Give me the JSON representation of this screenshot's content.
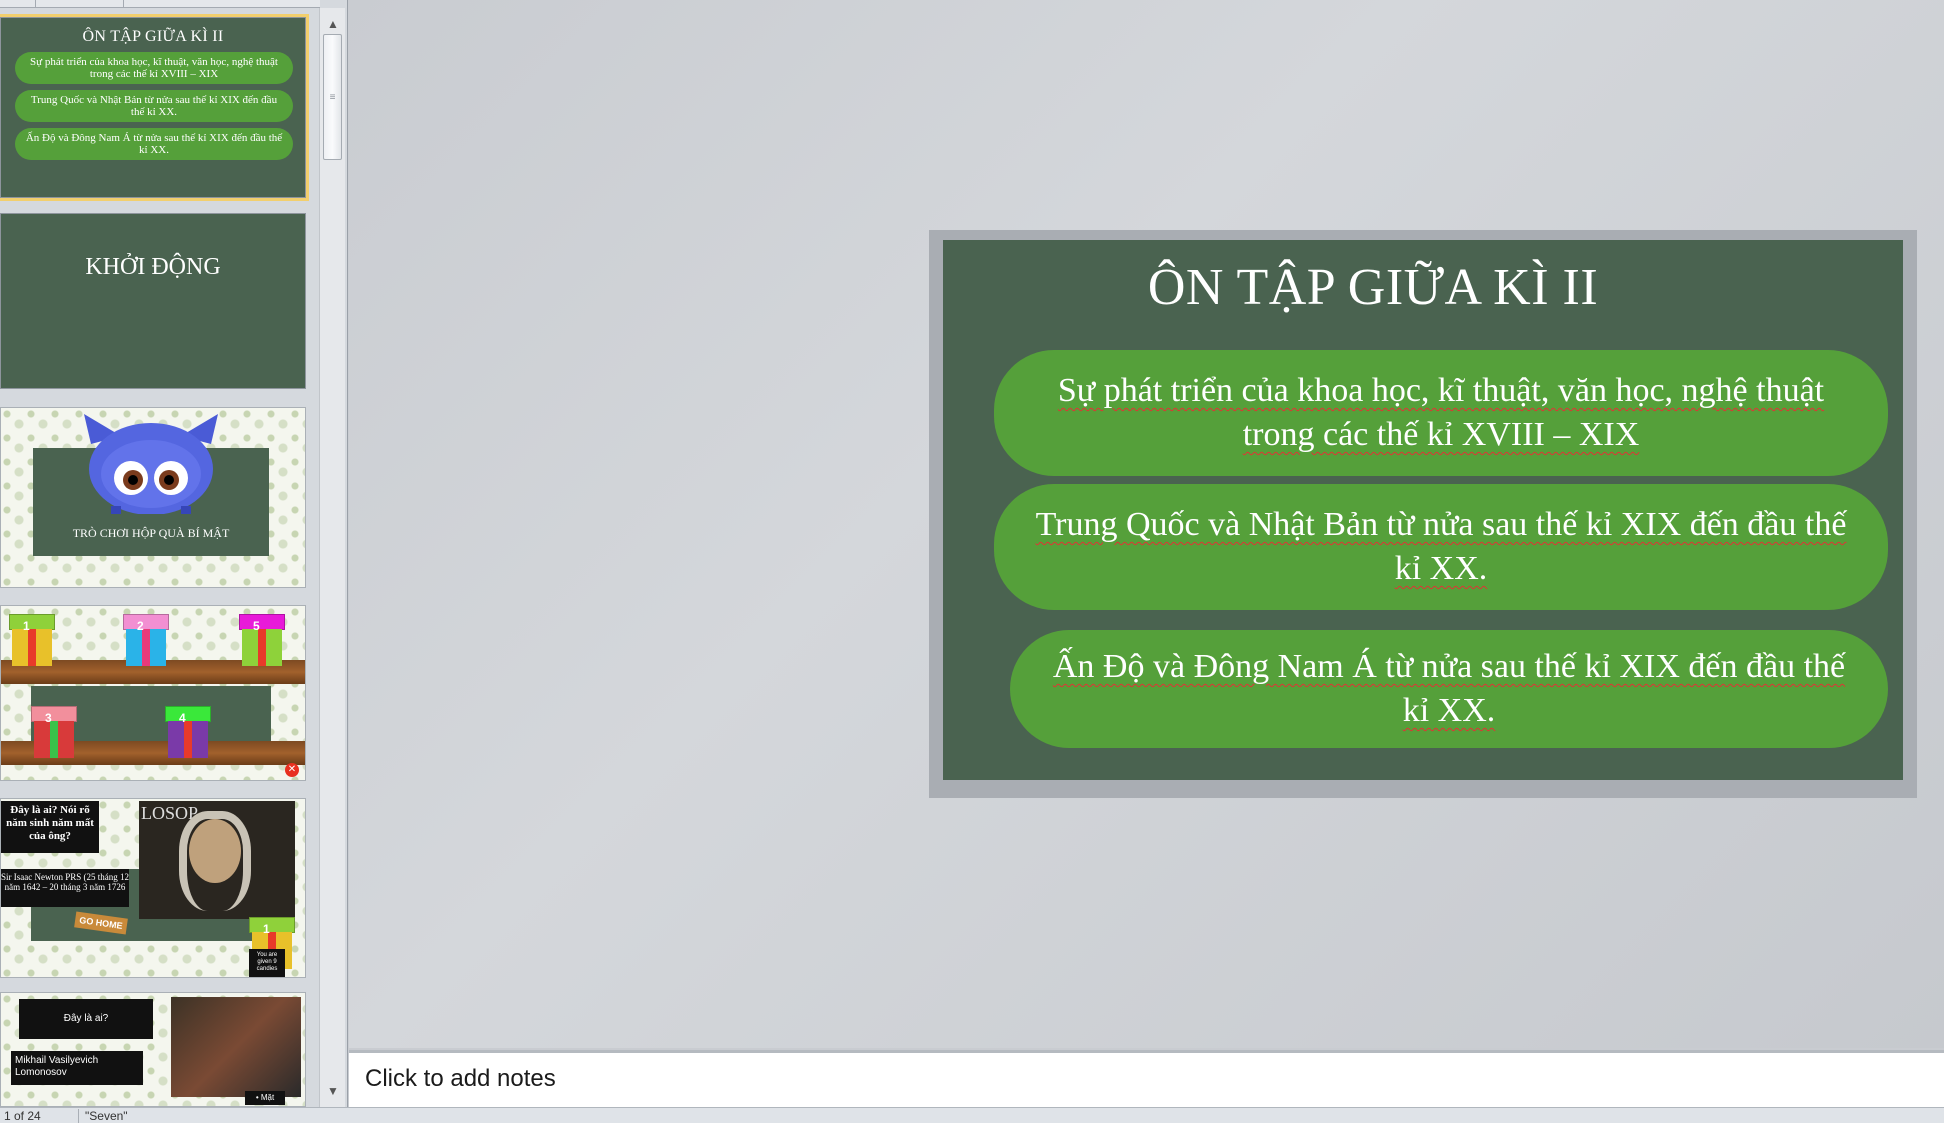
{
  "thumbnails": {
    "slide1": {
      "title": "ÔN TẬP GIỮA KÌ II",
      "items": [
        "Sự phát triển của khoa học, kĩ thuật, văn học, nghệ thuật trong các thế kỉ XVIII – XIX",
        "Trung Quốc và Nhật Bản từ nửa sau thế kỉ XIX đến đầu thế kỉ XX.",
        "Ấn Độ và Đông Nam Á từ nửa sau thế kỉ XIX đến đầu thế kỉ XX."
      ]
    },
    "slide2": {
      "title": "KHỞI ĐỘNG"
    },
    "slide3": {
      "caption": "TRÒ CHƠI HỘP QUÀ BÍ MẬT"
    },
    "slide4": {
      "gifts": [
        "1",
        "2",
        "5",
        "3",
        "4"
      ]
    },
    "slide5": {
      "question": "Đây là ai? Nói rõ năm sinh năm mất của ông?",
      "answer": "Sir Isaac Newton PRS (25 tháng 12 năm 1642 – 20 tháng 3 năm 1726",
      "go_home": "GO HOME",
      "gift_number": "1",
      "candies": "You are given 9 candies",
      "bg_word": "LOSOP"
    },
    "slide6": {
      "question": "Đây là ai?",
      "answer": "Mikhail Vasilyevich Lomonosov",
      "tag": "• Mặt"
    }
  },
  "slide": {
    "title": "ÔN TẬP GIỮA KÌ II",
    "items": [
      "Sự phát triển của khoa học, kĩ thuật, văn học, nghệ thuật trong các thế kỉ XVIII – XIX",
      "Trung Quốc và Nhật Bản từ nửa sau thế kỉ XIX đến đầu thế kỉ XX.",
      "Ấn Độ và Đông Nam Á từ nửa sau thế kỉ XIX đến đầu thế kỉ XX."
    ]
  },
  "notes": {
    "placeholder": "Click to add notes"
  },
  "status": {
    "slide_count": "1 of 24",
    "theme": "\"Seven\""
  },
  "icons": {
    "scroll_up": "scroll-up-icon",
    "scroll_down": "scroll-down-icon",
    "grip": "grip-icon"
  },
  "colors": {
    "slide_bg": "#4a6350",
    "pill": "#55a03a",
    "selection": "#f2cf6d"
  }
}
